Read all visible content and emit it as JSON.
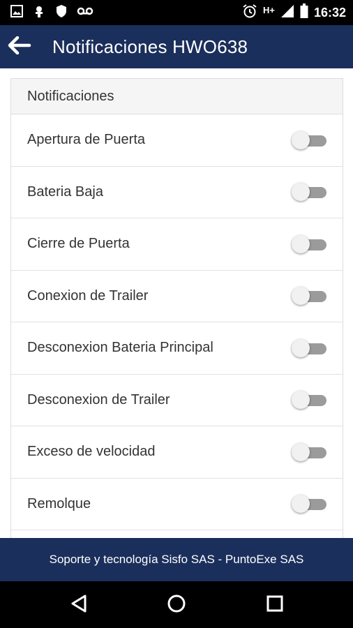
{
  "status_bar": {
    "time": "16:32",
    "network": "H+",
    "left_icons": [
      "image-icon",
      "android-icon",
      "shield-icon",
      "voicemail-icon"
    ],
    "right_icons": [
      "alarm-icon",
      "signal-icon",
      "battery-icon"
    ]
  },
  "app_bar": {
    "title": "Notificaciones HWO638",
    "back_icon": "arrow-left-icon",
    "background_color": "#1b2f5c"
  },
  "card": {
    "header": "Notificaciones",
    "items": [
      {
        "label": "Apertura de Puerta",
        "enabled": false
      },
      {
        "label": "Bateria Baja",
        "enabled": false
      },
      {
        "label": "Cierre de Puerta",
        "enabled": false
      },
      {
        "label": "Conexion de Trailer",
        "enabled": false
      },
      {
        "label": "Desconexion Bateria Principal",
        "enabled": false
      },
      {
        "label": "Desconexion de Trailer",
        "enabled": false
      },
      {
        "label": "Exceso de velocidad",
        "enabled": false
      },
      {
        "label": "Remolque",
        "enabled": false
      }
    ]
  },
  "footer": {
    "text": "Soporte y tecnología Sisfo SAS - PuntoExe SAS"
  },
  "nav_bar": {
    "buttons": [
      "back-triangle-icon",
      "home-circle-icon",
      "recents-square-icon"
    ]
  }
}
